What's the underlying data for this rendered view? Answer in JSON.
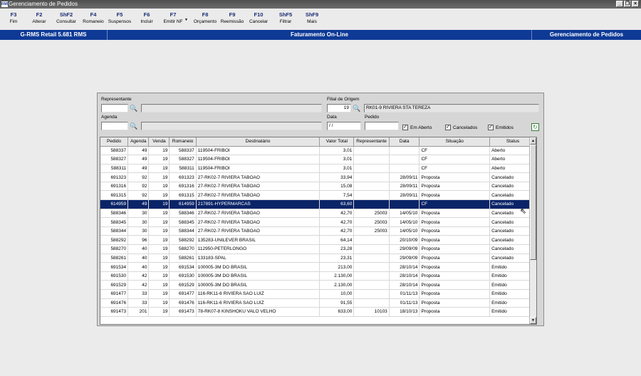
{
  "window": {
    "title": "Gerenciamento de Pedidos",
    "app_icon": "RMS"
  },
  "toolbar": [
    {
      "key": "F3",
      "label": "Fim"
    },
    {
      "key": "F2",
      "label": "Alterar"
    },
    {
      "key": "ShF2",
      "label": "Consultar"
    },
    {
      "key": "F4",
      "label": "Romaneio"
    },
    {
      "key": "F5",
      "label": "Suspensos"
    },
    {
      "key": "F6",
      "label": "Incluir"
    },
    {
      "key": "F7",
      "label": "Emitir NF"
    },
    {
      "key": "F8",
      "label": "Orçamento"
    },
    {
      "key": "F9",
      "label": "Reemissão"
    },
    {
      "key": "F10",
      "label": "Cancelar"
    },
    {
      "key": "ShF5",
      "label": "Filtrar"
    },
    {
      "key": "ShF9",
      "label": "Mais"
    }
  ],
  "statusbar": {
    "app": "G-RMS Retail 5.681 RMS",
    "module": "Faturamento On-Line",
    "screen": "Gerenciamento de Pedidos"
  },
  "filters": {
    "representante_label": "Representante",
    "representante_value": "",
    "agenda_label": "Agenda",
    "agenda_value": "",
    "filial_label": "Filial de Origem",
    "filial_code": "19",
    "filial_name": "RK01-9 RIVIERA STA TEREZA",
    "data_label": "Data",
    "data_value": " / /",
    "pedido_label": "Pedido",
    "pedido_value": "",
    "em_aberto_label": "Em Aberto",
    "cancelados_label": "Cancelados",
    "emitidos_label": "Emitidos",
    "em_aberto_checked": true,
    "cancelados_checked": true,
    "emitidos_checked": true
  },
  "grid": {
    "columns": [
      "Pedido",
      "Agenda",
      "Venda",
      "Romaneio",
      "Destinatário",
      "Valor Total",
      "Representante",
      "Data",
      "Situação",
      "Status"
    ],
    "selected_row": 6,
    "rows": [
      [
        "588337",
        "49",
        "19",
        "588337",
        "119504-FRIBOI",
        "3,01",
        "",
        "",
        "CF",
        "Aberto"
      ],
      [
        "588327",
        "49",
        "19",
        "588327",
        "119504-FRIBOI",
        "3,01",
        "",
        "",
        "CF",
        "Aberto"
      ],
      [
        "588311",
        "49",
        "19",
        "588311",
        "119504-FRIBOI",
        "3,01",
        "",
        "",
        "CF",
        "Aberto"
      ],
      [
        "691323",
        "92",
        "19",
        "691323",
        "27-RK02-7 RIVIERA TABOAO",
        "33,94",
        "",
        "28/09/11",
        "Proposta",
        "Cancelado"
      ],
      [
        "691316",
        "92",
        "19",
        "691316",
        "27-RK02-7 RIVIERA TABOAO",
        "15,08",
        "",
        "28/09/11",
        "Proposta",
        "Cancelado"
      ],
      [
        "691315",
        "92",
        "19",
        "691315",
        "27-RK02-7 RIVIERA TABOAO",
        "7,54",
        "",
        "28/09/11",
        "Proposta",
        "Cancelado"
      ],
      [
        "614959",
        "49",
        "19",
        "614959",
        "217891-HYPERMARCAS",
        "63,60",
        "",
        "",
        "CF",
        "Cancelado"
      ],
      [
        "588346",
        "30",
        "19",
        "588346",
        "27-RK02-7 RIVIERA TABOAO",
        "42,70",
        "25003",
        "14/05/10",
        "Proposta",
        "Cancelado"
      ],
      [
        "588345",
        "30",
        "19",
        "588345",
        "27-RK02-7 RIVIERA TABOAO",
        "42,70",
        "25003",
        "14/05/10",
        "Proposta",
        "Cancelado"
      ],
      [
        "588344",
        "30",
        "19",
        "588344",
        "27-RK02-7 RIVIERA TABOAO",
        "42,70",
        "25003",
        "14/05/10",
        "Proposta",
        "Cancelado"
      ],
      [
        "588292",
        "96",
        "19",
        "588292",
        "135283-UNILEVER BRASIL",
        "64,14",
        "",
        "20/10/09",
        "Proposta",
        "Cancelado"
      ],
      [
        "588270",
        "40",
        "19",
        "588270",
        "112950-PETERLONGO",
        "23,28",
        "",
        "29/09/09",
        "Proposta",
        "Cancelado"
      ],
      [
        "588261",
        "40",
        "19",
        "588261",
        "133183-SPAL",
        "23,31",
        "",
        "29/09/09",
        "Proposta",
        "Cancelado"
      ],
      [
        "691534",
        "40",
        "19",
        "691534",
        "100005-3M DO BRASIL",
        "213,00",
        "",
        "28/10/14",
        "Proposta",
        "Emitido"
      ],
      [
        "691530",
        "42",
        "19",
        "691530",
        "100005-3M DO BRASIL",
        "2.130,00",
        "",
        "28/10/14",
        "Proposta",
        "Emitido"
      ],
      [
        "691529",
        "42",
        "19",
        "691529",
        "100005-3M DO BRASIL",
        "2.130,00",
        "",
        "28/10/14",
        "Proposta",
        "Emitido"
      ],
      [
        "691477",
        "33",
        "19",
        "691477",
        "116-RK11-6 RIVIERA SAO LUIZ",
        "10,00",
        "",
        "01/11/13",
        "Proposta",
        "Emitido"
      ],
      [
        "691476",
        "33",
        "19",
        "691476",
        "116-RK11-6 RIVIERA SAO LUIZ",
        "91,55",
        "",
        "01/11/13",
        "Proposta",
        "Emitido"
      ],
      [
        "691473",
        "201",
        "19",
        "691473",
        "78-RK07-8 KINSHOKU VALO VELHO",
        "633,00",
        "10103",
        "18/10/13",
        "Proposta",
        "Emitido"
      ]
    ]
  },
  "colors": {
    "title_bar": "#5a5a5a",
    "status_bar": "#0e3a96",
    "selection": "#0a2468",
    "fkey": "#1a2b75"
  }
}
